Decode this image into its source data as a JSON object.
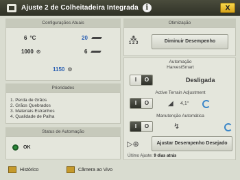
{
  "window": {
    "title": "Ajuste 2 de Colheitadeira Integrada",
    "close_label": "X"
  },
  "left": {
    "settings_header": "Configurações Atuais",
    "settings": {
      "row1_left_value": "6",
      "row1_left_unit": "°C",
      "row1_right_value": "20",
      "row2_left_value": "1000",
      "row2_right_value": "6",
      "row3_value": "1150"
    },
    "priorities_header": "Prioridades",
    "priorities": [
      "1. Perda de Grãos",
      "2. Grãos Quebrados",
      "3. Materiais Estranhos",
      "4. Qualidade de Palha"
    ],
    "automation_status_header": "Status de Automação",
    "automation_status": "OK",
    "history_label": "Histórico",
    "live_camera_label": "Câmera ao Vivo"
  },
  "right": {
    "optimization_header": "Otimização",
    "steps_label": "1 2 3",
    "reduce_button": "Diminuir Desempenho",
    "automation_header": "Automação",
    "harvest_smart_label": "HarvestSmart",
    "toggle_off": "I",
    "toggle_on": "O",
    "harvest_status": "Desligada",
    "ata_label": "Active Terrain Adjustment",
    "angle_value": "4,1°",
    "auto_maint_label": "Manutenção Automática",
    "adjust_button": "Ajustar Desempenho Desejado",
    "last_adjust_label": "Último Ajuste:",
    "last_adjust_value": "9 dias atrás"
  }
}
